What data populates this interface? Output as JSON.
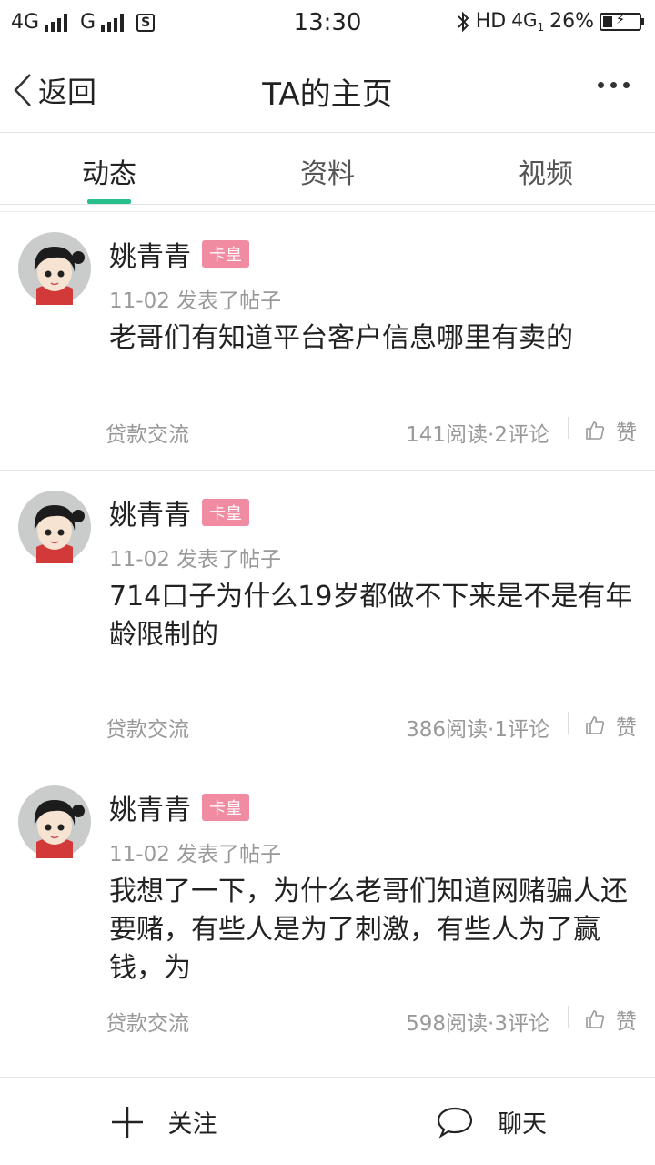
{
  "status_bar": {
    "network1": "4G",
    "network2": "G",
    "sim_icon": "S",
    "time": "13:30",
    "hd_label": "HD",
    "network3": "4G",
    "network3_sub": "1",
    "battery_text": "26%",
    "battery_level": 0.26,
    "icons": [
      "signal-bars-icon",
      "sim-card-icon",
      "bluetooth-icon",
      "battery-charging-icon"
    ]
  },
  "header": {
    "back_label": "返回",
    "title": "TA的主页",
    "more_icon": "more-dots-icon"
  },
  "tabs": [
    {
      "label": "动态",
      "active": true
    },
    {
      "label": "资料",
      "active": false
    },
    {
      "label": "视频",
      "active": false
    }
  ],
  "accent_color": "#27c08a",
  "badge_color": "#f08ba2",
  "posts": [
    {
      "author": "姚青青",
      "badge": "卡皇",
      "meta": "11-02 发表了帖子",
      "text": "老哥们有知道平台客户信息哪里有卖的",
      "category": "贷款交流",
      "stats": "141阅读·2评论",
      "like_label": "赞"
    },
    {
      "author": "姚青青",
      "badge": "卡皇",
      "meta": "11-02 发表了帖子",
      "text": "714口子为什么19岁都做不下来是不是有年龄限制的",
      "category": "贷款交流",
      "stats": "386阅读·1评论",
      "like_label": "赞"
    },
    {
      "author": "姚青青",
      "badge": "卡皇",
      "meta": "11-02 发表了帖子",
      "text": "我想了一下，为什么老哥们知道网赌骗人还要赌，有些人是为了刺激，有些人为了赢钱，为",
      "category": "贷款交流",
      "stats": "598阅读·3评论",
      "like_label": "赞"
    }
  ],
  "bottom_bar": {
    "follow_label": "关注",
    "chat_label": "聊天"
  }
}
